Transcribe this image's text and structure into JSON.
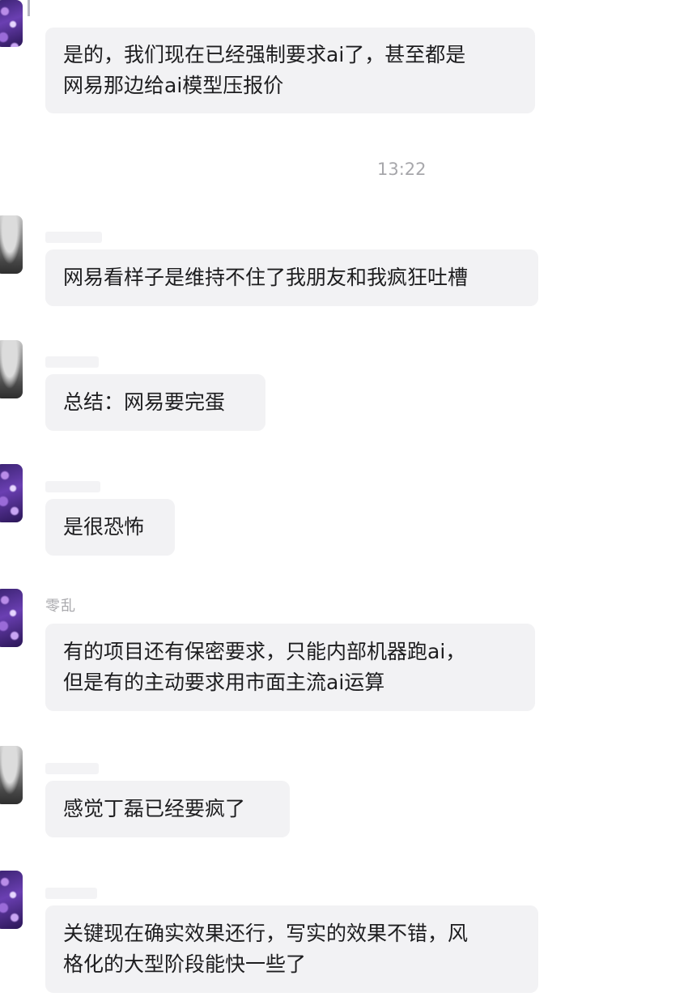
{
  "timestamp": "13:22",
  "messages": [
    {
      "sender": "",
      "lines": [
        "是的，我们现在已经强制要求ai了，甚至都是",
        "网易那边给ai模型压报价"
      ]
    },
    {
      "sender": "",
      "lines": [
        "网易看样子是维持不住了我朋友和我疯狂吐槽"
      ]
    },
    {
      "sender": "",
      "lines": [
        "总结：网易要完蛋"
      ]
    },
    {
      "sender": "",
      "lines": [
        "是很恐怖"
      ]
    },
    {
      "sender": "零乱",
      "lines": [
        "有的项目还有保密要求，只能内部机器跑ai，",
        "但是有的主动要求用市面主流ai运算"
      ]
    },
    {
      "sender": "",
      "lines": [
        "感觉丁磊已经要疯了"
      ]
    },
    {
      "sender": "",
      "lines": [
        "关键现在确实效果还行，写实的效果不错，风",
        "格化的大型阶段能快一些了"
      ]
    }
  ],
  "avatars": [
    "purple",
    "gray",
    "gray",
    "purple",
    "purple",
    "gray",
    "purple"
  ]
}
